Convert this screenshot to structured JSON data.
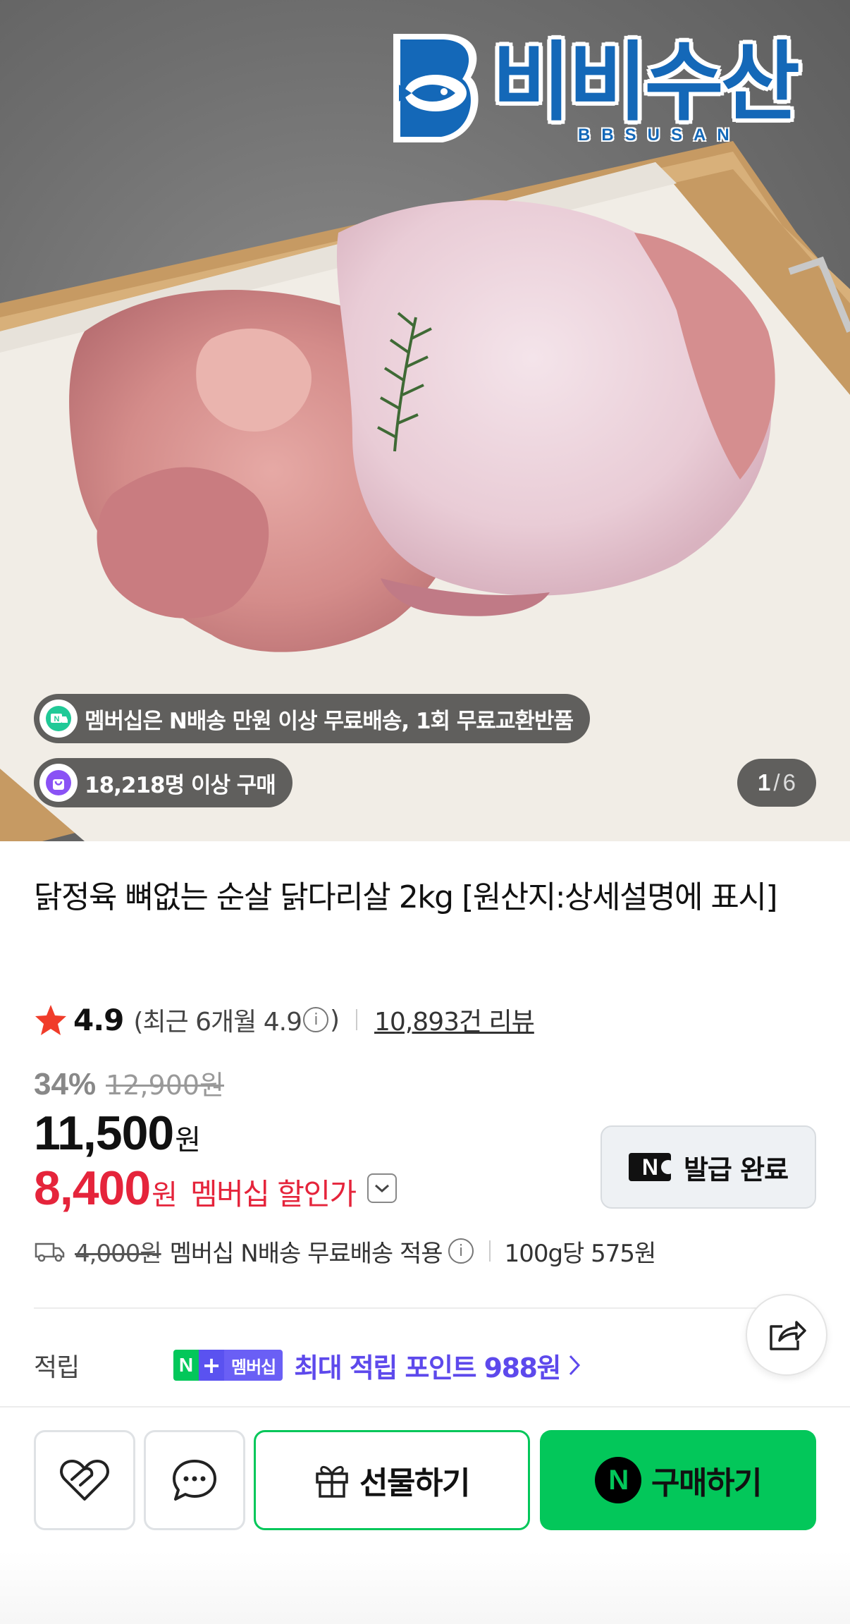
{
  "hero": {
    "logo_text": "비비수산",
    "logo_sub": "BBSUSAN",
    "membership_notice": "멤버십은 N배송 만원 이상 무료배송, 1회 무료교환반품",
    "purchase_count": "18,218명 이상 구매",
    "image_index": "1",
    "image_separator": "/",
    "image_total": "6"
  },
  "product": {
    "title": "닭정육 뼈없는 순살 닭다리살 2kg [원산지:상세설명에 표시]",
    "rating": "4.9",
    "recent_rating_prefix": "(최근 6개월 4.9",
    "recent_rating_suffix": ")",
    "review_count": "10,893건 리뷰"
  },
  "pricing": {
    "discount_percent": "34%",
    "original_price": "12,900원",
    "sale_price": "11,500",
    "currency": "원",
    "member_price": "8,400",
    "member_label": "멤버십 할인가",
    "coupon_badge": "N",
    "coupon_label": "발급 완료"
  },
  "shipping": {
    "old_fee": "4,000원",
    "text": "멤버십 N배송 무료배송 적용",
    "unit_price": "100g당 575원"
  },
  "points": {
    "label": "적립",
    "badge_n": "N",
    "badge_plus": "+",
    "badge_member": "멤버십",
    "text": "최대 적립 포인트 988원"
  },
  "actions": {
    "gift_label": "선물하기",
    "buy_badge": "N",
    "buy_label": "구매하기"
  },
  "colors": {
    "naver_green": "#03c75a",
    "member_red": "#e5243b",
    "points_purple": "#5d49ec",
    "logo_blue": "#1468b8"
  }
}
